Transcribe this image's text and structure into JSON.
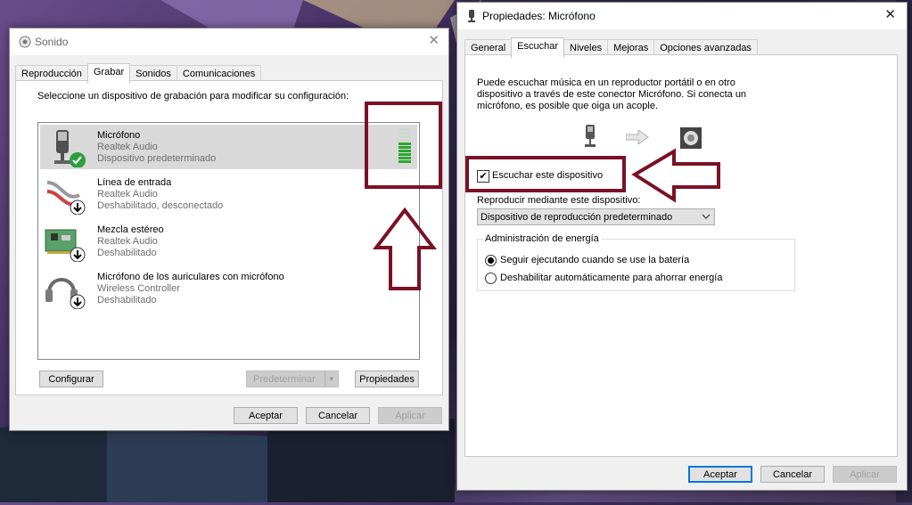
{
  "sound": {
    "title": "Sonido",
    "tabs": [
      "Reproducción",
      "Grabar",
      "Sonidos",
      "Comunicaciones"
    ],
    "instruction": "Seleccione un dispositivo de grabación para modificar su configuración:",
    "devices": [
      {
        "name": "Micrófono",
        "vendor": "Realtek Audio",
        "status": "Dispositivo predeterminado"
      },
      {
        "name": "Línea de entrada",
        "vendor": "Realtek Audio",
        "status": "Deshabilitado, desconectado"
      },
      {
        "name": "Mezcla estéreo",
        "vendor": "Realtek Audio",
        "status": "Deshabilitado"
      },
      {
        "name": "Micrófono de los auriculares con micrófono",
        "vendor": "Wireless Controller",
        "status": "Deshabilitado"
      }
    ],
    "level_bars": 10,
    "level_active": 6,
    "buttons": {
      "configure": "Configurar",
      "set_default": "Predeterminar",
      "properties": "Propiedades",
      "ok": "Aceptar",
      "cancel": "Cancelar",
      "apply": "Aplicar"
    }
  },
  "props": {
    "title": "Propiedades: Micrófono",
    "tabs": [
      "General",
      "Escuchar",
      "Niveles",
      "Mejoras",
      "Opciones avanzadas"
    ],
    "description_lines": [
      "Puede escuchar música en un reproductor portátil o en otro",
      "dispositivo a través de este conector Micrófono. Si conecta un",
      "micrófono, es posible que oiga un acople."
    ],
    "listen_checkbox": "Escuchar este dispositivo",
    "listen_checked": true,
    "playback_label": "Reproducir mediante este dispositivo:",
    "playback_value": "Dispositivo de reproducción predeterminado",
    "power_group": "Administración de energía",
    "power_options": [
      "Seguir ejecutando cuando se use la batería",
      "Deshabilitar automáticamente para ahorrar energía"
    ],
    "power_selected": 0,
    "buttons": {
      "ok": "Aceptar",
      "cancel": "Cancelar",
      "apply": "Aplicar"
    }
  },
  "colors": {
    "accent": "#0078d7",
    "annotation": "#7b1125",
    "level_on": "#2fa52f",
    "level_off": "#cfd8cf"
  }
}
